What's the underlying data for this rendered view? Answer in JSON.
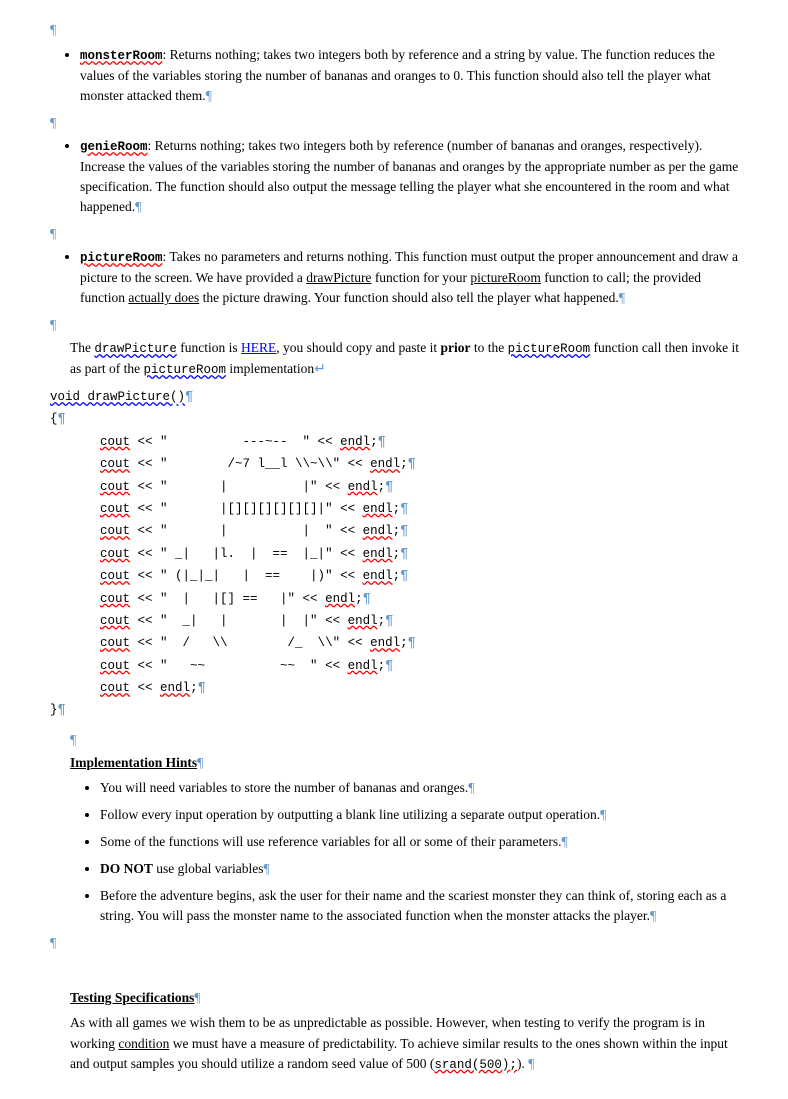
{
  "pilcrow": "¶",
  "sections": {
    "monsterRoom": {
      "label": "monsterRoom",
      "text": ": Returns nothing; takes two integers both by reference and a string by value. The function reduces the values of the variables storing the number of bananas and oranges to 0. This function should also tell the player what monster attacked them."
    },
    "genieRoom": {
      "label": "genieRoom",
      "text": ": Returns nothing; takes two integers both by reference (number of bananas and oranges, respectively). Increase the values of the variables storing the number of bananas and oranges by the appropriate number as per the game specification. The function should also output the message telling the player what she encountered in the room and what happened."
    },
    "pictureRoom": {
      "label": "pictureRoom",
      "text1": ": Takes no parameters and returns nothing. This function must output the proper announcement and draw a picture to the screen. We have provided a ",
      "drawPicture1": "drawPicture",
      "text2": " function for your ",
      "pictureRoom2": "pictureRoom",
      "text3": " function to call; the provided function ",
      "actuallyDoes": "actually does",
      "text4": " the picture drawing.  Your function should also tell the player what happened."
    },
    "drawPictureDesc": {
      "text1": "The ",
      "drawPicture": "drawPicture",
      "text2": " function is ",
      "hereLink": "HERE",
      "text3": ", you should copy and paste it ",
      "prior": "prior",
      "text4": " to the ",
      "pictureRoom": "pictureRoom",
      "text5": " function call then invoke it as part of the ",
      "pictureRoom2": "pictureRoom",
      "text6": " implementation"
    },
    "codeBlock": {
      "signature": "void drawPicture()¶",
      "lines": [
        "{¶",
        "    cout << \"          ---~--  \" << endl;¶",
        "    cout << \"         /~7 l__l \\\\~\\\\\" << endl;¶",
        "    cout << \"        |          |\" << endl;¶",
        "    cout << \"        |[][][][][][]|\" << endl;¶",
        "    cout << \"        |          |  \" << endl;¶",
        "    cout << \" _|   |l.  |  ==  |_|\" << endl;¶",
        "    cout << \" (|_|_|   |  ==    |)\" << endl;¶",
        "    cout << \"  |   |[] ==   |\" << endl;¶",
        "    cout << \"  _|   |       |  |\" << endl;¶",
        "    cout << \"  /   \\\\        /_  \\\\\" << endl;¶",
        "    cout << \"   ~~          ~~  \" << endl;¶",
        "    cout << endl;¶",
        "}¶"
      ]
    },
    "implementationHints": {
      "title": "Implementation Hints",
      "bullets": [
        "You will need variables to store the number of bananas and oranges.",
        "Follow every input operation by outputting a blank line utilizing a separate output operation.",
        "Some of the functions will use reference variables for all or some of their parameters.",
        "DO NOT use global variables",
        "Before the adventure begins, ask the user for their name and the scariest monster they can think of, storing each as a string.  You will pass the monster name to the associated function when the monster attacks the player."
      ],
      "doNotBold": "DO NOT"
    },
    "testingSpecifications": {
      "title": "Testing Specifications",
      "text": "As with all games we wish them to be as unpredictable as possible.  However, when testing to verify the program is in working ",
      "condition": "condition",
      "text2": " we must have a measure of predictability.  To achieve similar results to the ones shown within the input and output samples you should utilize a random seed value of 500 (",
      "srand": "srand(500);",
      "text3": ")."
    }
  }
}
